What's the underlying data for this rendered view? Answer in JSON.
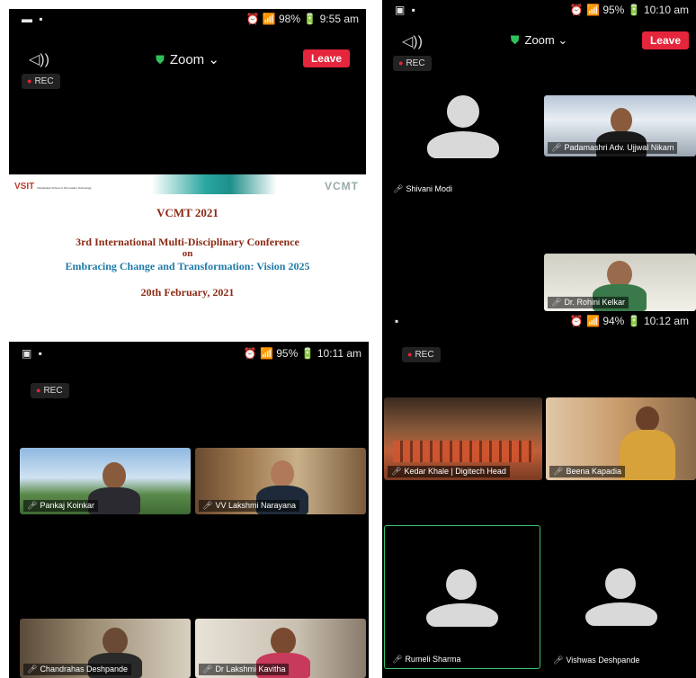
{
  "screens": [
    {
      "status": {
        "left": "▬ ▪",
        "right": "⏰ 📶 98% 🔋 9:55 am"
      },
      "app": {
        "title": "Zoom",
        "leave": "Leave",
        "rec": "REC"
      },
      "slide": {
        "logo_left": "VSIT",
        "logo_left_sub": "Vidyalankar School of Information Technology",
        "logo_right": "VCMT",
        "title": "VCMT 2021",
        "line1": "3rd International Multi-Disciplinary Conference",
        "line2": "on",
        "line3": "Embracing Change and Transformation: Vision 2025",
        "date": "20th February, 2021"
      }
    },
    {
      "status": {
        "left": "▣ ▪",
        "right": "⏰ 📶 95% 🔋 10:10 am"
      },
      "app": {
        "title": "Zoom",
        "leave": "Leave",
        "rec": "REC"
      },
      "participants": [
        "Shivani Modi",
        "Padamashri Adv. Ujjwal Nikam",
        "Dr. Rohini Kelkar"
      ]
    },
    {
      "status": {
        "left": "▣ ▪",
        "right": "⏰ 📶 95% 🔋 10:11 am"
      },
      "app": {
        "rec": "REC"
      },
      "participants": [
        "Pankaj Koinkar",
        "VV Lakshmi Narayana",
        "Chandrahas Deshpande",
        "Dr Lakshmi Kavitha"
      ]
    },
    {
      "status": {
        "left": "▪",
        "right": "⏰ 📶 94% 🔋 10:12 am"
      },
      "app": {
        "rec": "REC"
      },
      "participants": [
        "Kedar Khale | Digitech Head",
        "Beena Kapadia",
        "Rumeli Sharma",
        "Vishwas Deshpande"
      ]
    }
  ],
  "colors": {
    "leave": "#e5253b",
    "shield": "#2fc25b",
    "active_speaker": "#3ac06a"
  }
}
